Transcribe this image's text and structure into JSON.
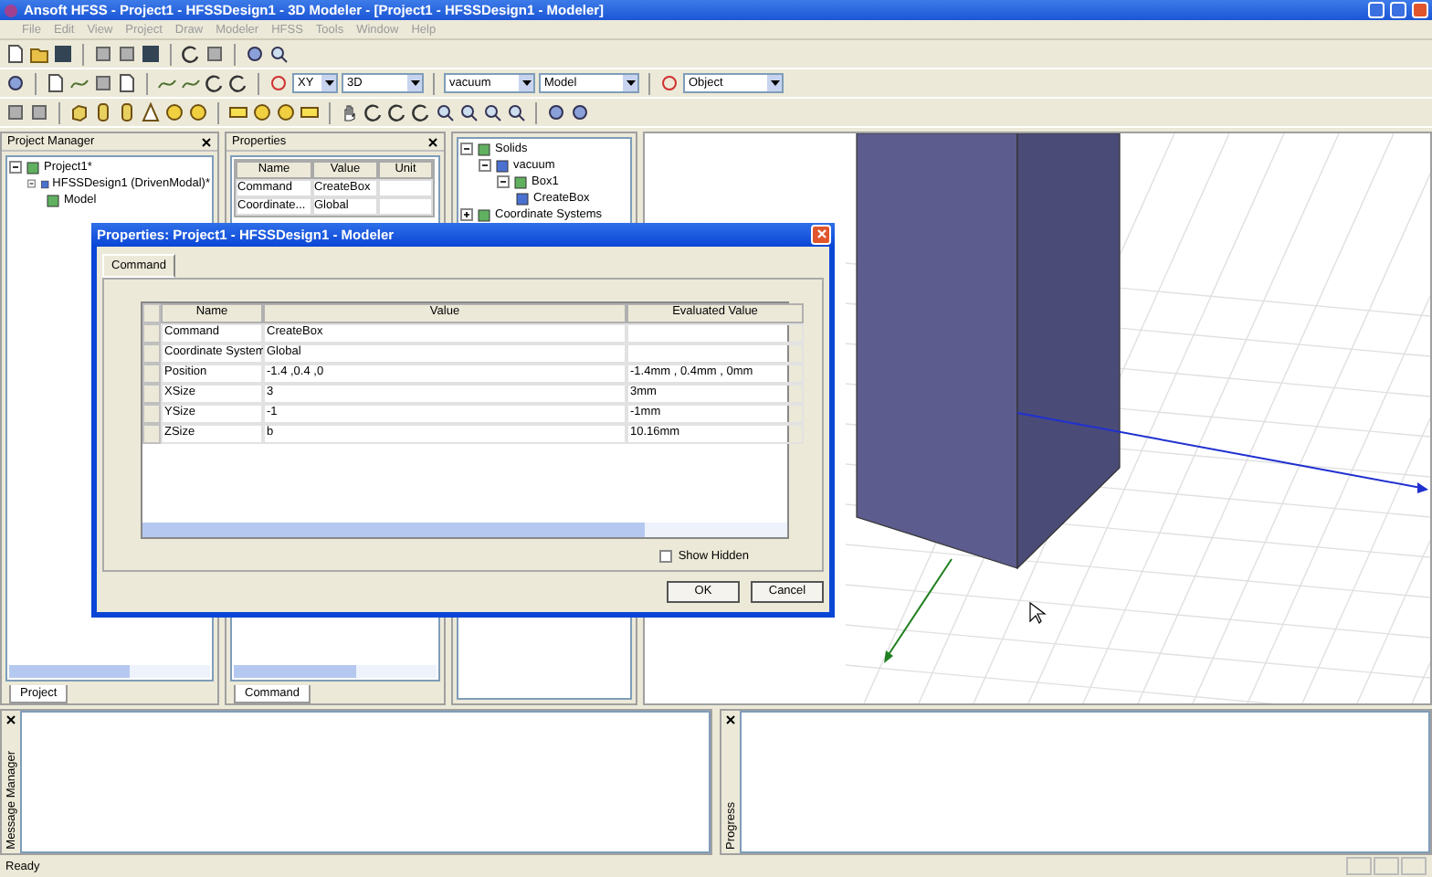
{
  "window": {
    "title": "Ansoft HFSS - Project1 - HFSSDesign1 - 3D Modeler - [Project1 - HFSSDesign1 - Modeler]"
  },
  "menu": [
    "File",
    "Edit",
    "View",
    "Project",
    "Draw",
    "Modeler",
    "HFSS",
    "Tools",
    "Window",
    "Help"
  ],
  "toolbar": {
    "dropdowns": [
      {
        "value": "XY"
      },
      {
        "value": "3D"
      },
      {
        "value": "vacuum"
      },
      {
        "value": "Model"
      },
      {
        "value": "Object"
      }
    ]
  },
  "project_manager": {
    "title": "Project Manager",
    "tab": "Project",
    "tree": [
      {
        "label": "Project1*",
        "expanded": true,
        "children": [
          {
            "label": "HFSSDesign1 (DrivenModal)*",
            "expanded": true,
            "children": [
              {
                "label": "Model"
              }
            ]
          }
        ]
      }
    ]
  },
  "properties": {
    "title": "Properties",
    "tab": "Command",
    "columns": [
      "Name",
      "Value",
      "Unit"
    ],
    "rows": [
      [
        "Command",
        "CreateBox",
        ""
      ],
      [
        "Coordinate...",
        "Global",
        ""
      ]
    ]
  },
  "model_tree": [
    {
      "label": "Solids",
      "expanded": true,
      "children": [
        {
          "label": "vacuum",
          "expanded": true,
          "children": [
            {
              "label": "Box1",
              "expanded": true,
              "children": [
                {
                  "label": "CreateBox"
                }
              ]
            }
          ]
        }
      ]
    },
    {
      "label": "Coordinate Systems",
      "expanded": false
    }
  ],
  "dialog": {
    "title": "Properties: Project1 - HFSSDesign1 - Modeler",
    "tab": "Command",
    "columns": [
      "Name",
      "Value",
      "Evaluated Value"
    ],
    "rows": [
      [
        "Command",
        "CreateBox",
        ""
      ],
      [
        "Coordinate System",
        "Global",
        ""
      ],
      [
        "Position",
        "-1.4 ,0.4 ,0",
        "-1.4mm , 0.4mm , 0mm"
      ],
      [
        "XSize",
        "3",
        "3mm"
      ],
      [
        "YSize",
        "-1",
        "-1mm"
      ],
      [
        "ZSize",
        "b",
        "10.16mm"
      ]
    ],
    "show_hidden": {
      "label": "Show Hidden",
      "checked": false
    },
    "buttons": [
      "OK",
      "Cancel"
    ]
  },
  "bottom_panels": [
    "Message Manager",
    "Progress"
  ],
  "status_bar": "Ready"
}
